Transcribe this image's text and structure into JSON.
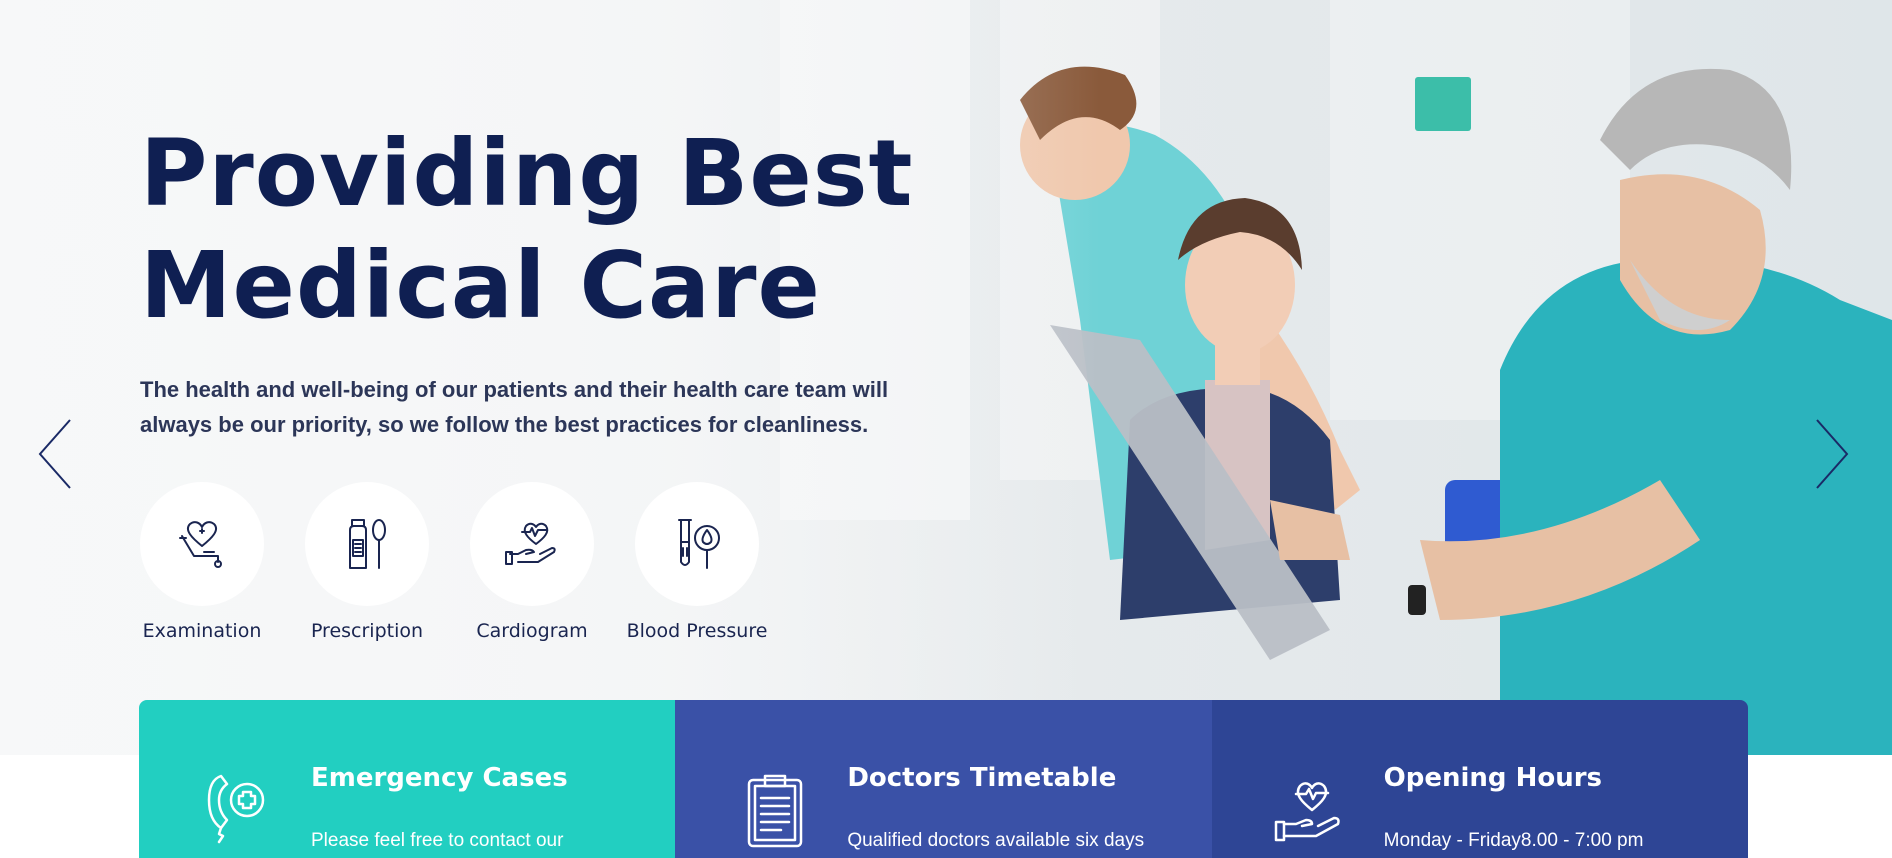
{
  "hero": {
    "title_line1": "Providing Best",
    "title_line2": "Medical Care",
    "description_line1": "The health and well-being of our patients and their health care team will",
    "description_line2": "always be our priority, so we follow the best practices for cleanliness.",
    "prev_arrow_icon": "chevron-left-icon",
    "next_arrow_icon": "chevron-right-icon"
  },
  "services": [
    {
      "label": "Examination",
      "icon": "stethoscope-heart-icon"
    },
    {
      "label": "Prescription",
      "icon": "medicine-bottle-spoon-icon"
    },
    {
      "label": "Cardiogram",
      "icon": "heartbeat-hand-icon"
    },
    {
      "label": "Blood Pressure",
      "icon": "test-tube-blood-drop-icon"
    }
  ],
  "info_cards": [
    {
      "title": "Emergency Cases",
      "text": "Please feel free to contact our",
      "icon": "emergency-phone-icon",
      "color": "#22cfc1"
    },
    {
      "title": "Doctors Timetable",
      "text": "Qualified doctors available six days",
      "icon": "clipboard-icon",
      "color": "#3a51a7"
    },
    {
      "title": "Opening Hours",
      "text": "Monday - Friday8.00 - 7:00 pm",
      "icon": "heart-hand-icon",
      "color": "#2e4595"
    }
  ],
  "colors": {
    "heading": "#0f1f52",
    "teal": "#22cfc1",
    "blue": "#3a51a7",
    "dark_blue": "#2e4595",
    "scrub": "#2bb3bd"
  }
}
